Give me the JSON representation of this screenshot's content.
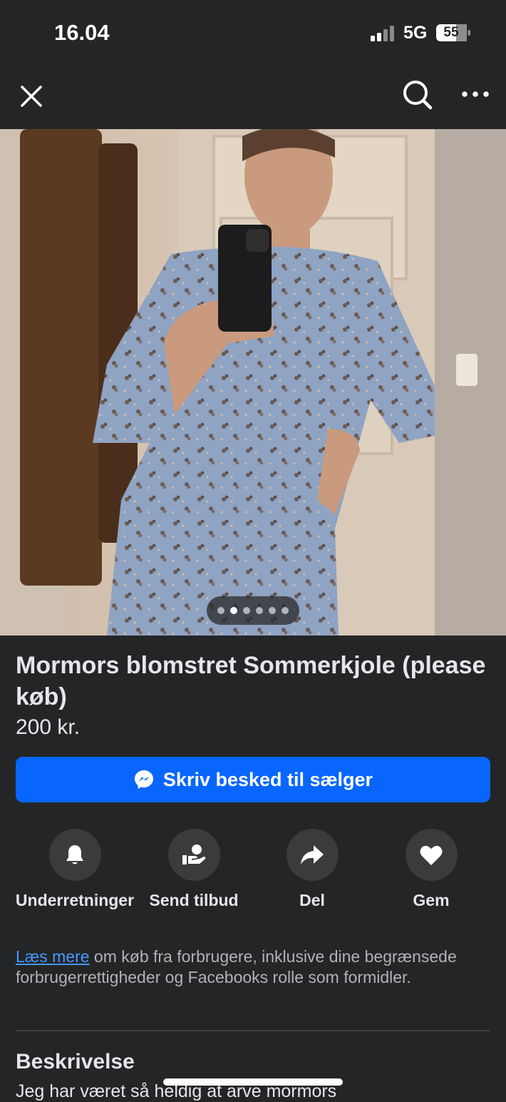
{
  "status_bar": {
    "time": "16.04",
    "network": "5G",
    "battery": "55"
  },
  "top_bar": {
    "close_icon": "close-icon",
    "search_icon": "search-icon",
    "more_icon": "more-icon"
  },
  "listing": {
    "title": "Mormors blomstret Sommerkjole (please køb)",
    "price": "200 kr.",
    "carousel": {
      "count": 6,
      "active_index": 1
    }
  },
  "message_button": {
    "label": "Skriv besked til sælger",
    "icon": "messenger-icon"
  },
  "actions": [
    {
      "label": "Underretninger",
      "icon": "bell-icon"
    },
    {
      "label": "Send tilbud",
      "icon": "offer-icon"
    },
    {
      "label": "Del",
      "icon": "share-icon"
    },
    {
      "label": "Gem",
      "icon": "heart-icon"
    }
  ],
  "info": {
    "link_text": "Læs mere",
    "text": " om køb fra forbrugere, inklusive dine begrænsede forbrugerrettigheder og Facebooks rolle som formidler."
  },
  "description_section": {
    "title": "Beskrivelse",
    "text": "Jeg har været så heldig at arve mormors"
  },
  "colors": {
    "background": "#242526",
    "accent": "#0866ff",
    "link": "#4599ff"
  }
}
